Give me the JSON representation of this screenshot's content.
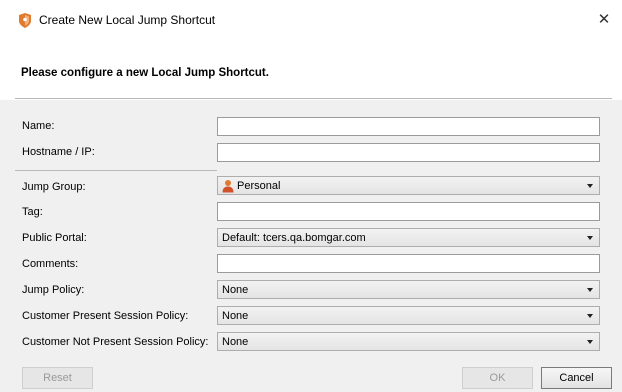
{
  "window": {
    "title": "Create New Local Jump Shortcut",
    "close_glyph": "✕"
  },
  "header": {
    "text": "Please configure a new Local Jump Shortcut."
  },
  "form": {
    "name": {
      "label": "Name:",
      "value": ""
    },
    "hostname": {
      "label": "Hostname / IP:",
      "value": ""
    },
    "jump_group": {
      "label": "Jump Group:",
      "value": "Personal",
      "icon": "person-icon"
    },
    "tag": {
      "label": "Tag:",
      "value": ""
    },
    "public_portal": {
      "label": "Public Portal:",
      "value": "Default: tcers.qa.bomgar.com"
    },
    "comments": {
      "label": "Comments:",
      "value": ""
    },
    "jump_policy": {
      "label": "Jump Policy:",
      "value": "None"
    },
    "customer_present_policy": {
      "label": "Customer Present Session Policy:",
      "value": "None"
    },
    "customer_not_present_policy": {
      "label": "Customer Not Present Session Policy:",
      "value": "None"
    }
  },
  "buttons": {
    "reset": "Reset",
    "ok": "OK",
    "cancel": "Cancel"
  },
  "colors": {
    "brand_orange": "#e07a2e",
    "disabled_text": "#9a9a9a"
  }
}
